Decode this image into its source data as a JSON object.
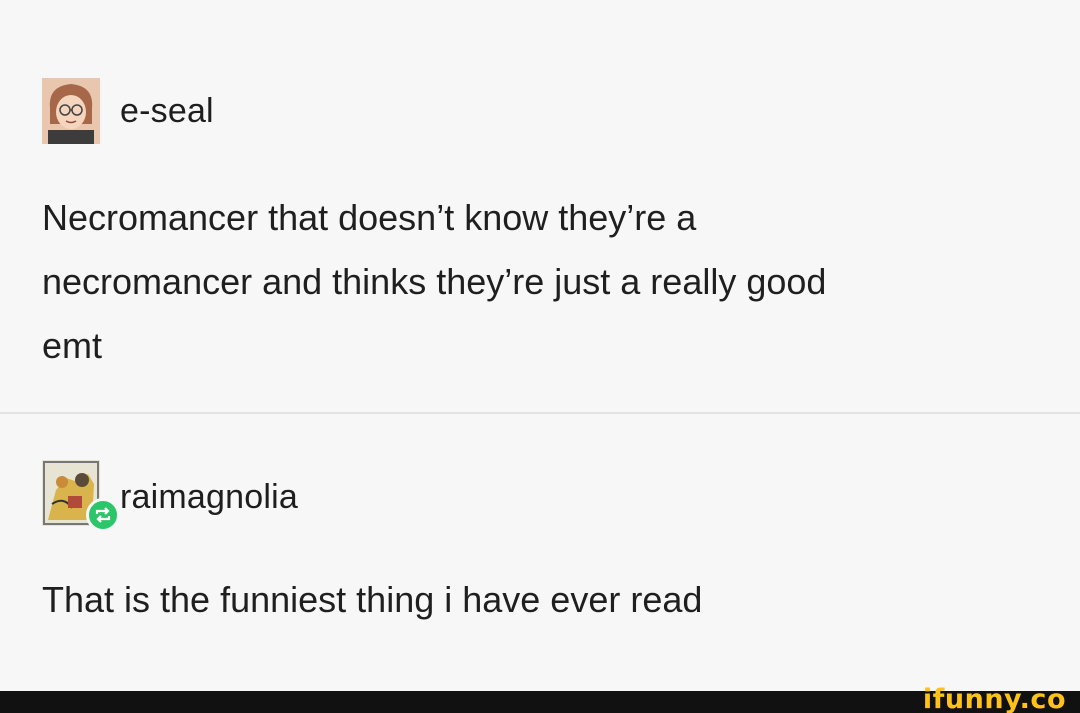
{
  "posts": [
    {
      "username": "e-seal",
      "avatar_icon": "cartoon-person-avatar-icon",
      "body": "Necromancer that doesn’t know they’re a\nnecromancer and thinks they’re just a really good\nemt"
    },
    {
      "username": "raimagnolia",
      "avatar_icon": "collage-avatar-icon",
      "badge_icon": "reblog-icon",
      "badge_color": "#2bc56a",
      "body": "That is the funniest thing i have ever read"
    }
  ],
  "watermark": "ifunny.co",
  "watermark_color": "#ffc21a"
}
